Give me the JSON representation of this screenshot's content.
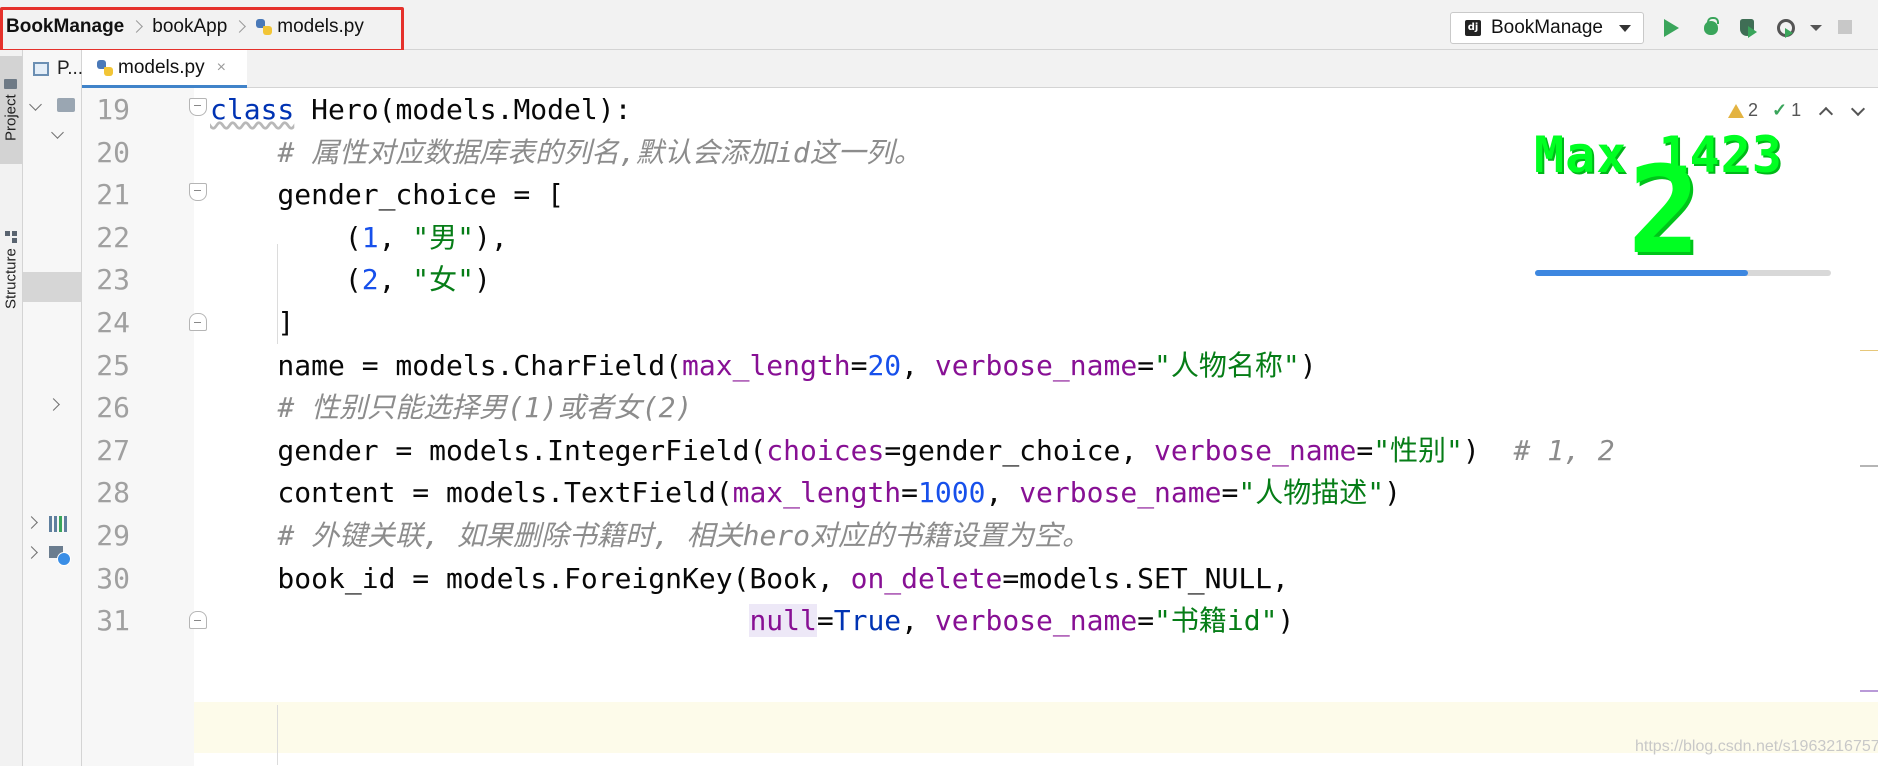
{
  "breadcrumb": {
    "project": "BookManage",
    "app": "bookApp",
    "file": "models.py"
  },
  "run_config": {
    "label": "BookManage",
    "icon": "django-icon"
  },
  "toolstrip": {
    "project_tab": "Project",
    "structure_tab": "Structure"
  },
  "project_panel": {
    "tab_label": "P..."
  },
  "editor_tab": {
    "label": "models.py",
    "close": "×"
  },
  "inspections": {
    "warnings": "2",
    "ok": "1"
  },
  "overlay": {
    "title": "Max 1423",
    "value": "2",
    "progress": 0.72,
    "bar_color": "#3d87e0",
    "text_color": "#00ff22"
  },
  "watermark": "https://blog.csdn.net/s1963216757",
  "colors": {
    "keyword": "#0033b3",
    "comment": "#8c8c8c",
    "number": "#1750eb",
    "string": "#067d17",
    "param": "#871094"
  },
  "code_lines": [
    {
      "n": "19",
      "fold": "open",
      "tokens": [
        [
          "kw wavy",
          "class"
        ],
        [
          "tx",
          " Hero(models.Model):"
        ]
      ]
    },
    {
      "n": "20",
      "fold": "",
      "tokens": [
        [
          "tx",
          "    "
        ],
        [
          "cm",
          "# 属性对应数据库表的列名,默认会添加id这一列。"
        ]
      ]
    },
    {
      "n": "21",
      "fold": "open",
      "tokens": [
        [
          "tx",
          "    gender_choice = ["
        ]
      ]
    },
    {
      "n": "22",
      "fold": "",
      "tokens": [
        [
          "tx",
          "        ("
        ],
        [
          "num",
          "1"
        ],
        [
          "tx",
          ", "
        ],
        [
          "str",
          "\"男\""
        ],
        [
          "tx",
          "),"
        ]
      ]
    },
    {
      "n": "23",
      "fold": "",
      "tokens": [
        [
          "tx",
          "        ("
        ],
        [
          "num",
          "2"
        ],
        [
          "tx",
          ", "
        ],
        [
          "str",
          "\"女\""
        ],
        [
          "tx",
          ")"
        ]
      ]
    },
    {
      "n": "24",
      "fold": "close",
      "tokens": [
        [
          "tx",
          "    ]"
        ]
      ]
    },
    {
      "n": "25",
      "fold": "",
      "tokens": [
        [
          "tx",
          "    name = models.CharField("
        ],
        [
          "pn",
          "max_length"
        ],
        [
          "tx",
          "="
        ],
        [
          "num",
          "20"
        ],
        [
          "tx",
          ", "
        ],
        [
          "pn",
          "verbose_name"
        ],
        [
          "tx",
          "="
        ],
        [
          "str",
          "\"人物名称\""
        ],
        [
          "tx",
          ")"
        ]
      ]
    },
    {
      "n": "26",
      "fold": "",
      "tokens": [
        [
          "tx",
          "    "
        ],
        [
          "cm",
          "# 性别只能选择男(1)或者女(2)"
        ]
      ]
    },
    {
      "n": "27",
      "fold": "",
      "tokens": [
        [
          "tx",
          "    gender = models.IntegerField("
        ],
        [
          "pn",
          "choices"
        ],
        [
          "tx",
          "=gender_choice, "
        ],
        [
          "pn",
          "verbose_name"
        ],
        [
          "tx",
          "="
        ],
        [
          "str",
          "\"性别\""
        ],
        [
          "tx",
          ")  "
        ],
        [
          "cm",
          "# 1, 2"
        ]
      ]
    },
    {
      "n": "28",
      "fold": "",
      "tokens": [
        [
          "tx",
          "    content = models.TextField("
        ],
        [
          "pn",
          "max_length"
        ],
        [
          "tx",
          "="
        ],
        [
          "num",
          "1000"
        ],
        [
          "tx",
          ", "
        ],
        [
          "pn",
          "verbose_name"
        ],
        [
          "tx",
          "="
        ],
        [
          "str",
          "\"人物描述\""
        ],
        [
          "tx",
          ")"
        ]
      ]
    },
    {
      "n": "29",
      "fold": "",
      "tokens": [
        [
          "tx",
          "    "
        ],
        [
          "cm",
          "# 外键关联, 如果删除书籍时, 相关hero对应的书籍设置为空。"
        ]
      ]
    },
    {
      "n": "30",
      "fold": "",
      "tokens": [
        [
          "tx",
          "    book_id = models.ForeignKey(Book, "
        ],
        [
          "pn",
          "on_delete"
        ],
        [
          "tx",
          "=models.SET_NULL,"
        ]
      ]
    },
    {
      "n": "31",
      "fold": "close",
      "tokens": [
        [
          "tx",
          "                                "
        ],
        [
          "pn null-bg",
          "null"
        ],
        [
          "tx",
          "="
        ],
        [
          "kw",
          "True"
        ],
        [
          "tx",
          ", "
        ],
        [
          "pn",
          "verbose_name"
        ],
        [
          "tx",
          "="
        ],
        [
          "str",
          "\"书籍id\""
        ],
        [
          "tx",
          ")"
        ]
      ]
    }
  ]
}
